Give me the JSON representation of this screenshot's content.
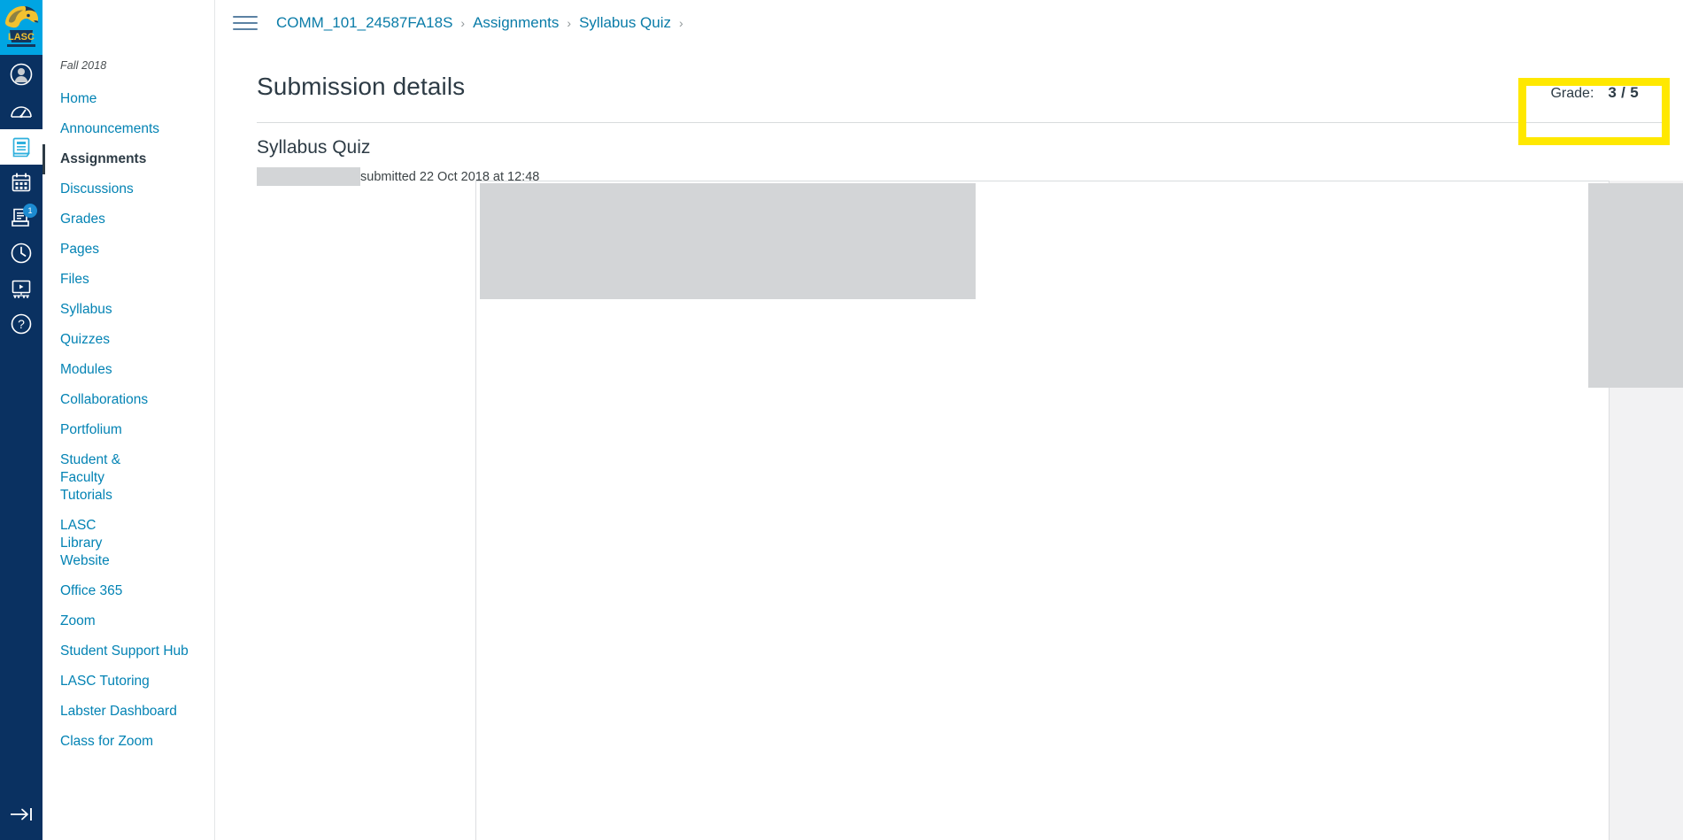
{
  "global_nav": {
    "logo": {
      "name": "lasc-cougar-logo",
      "alt": "LASC Cougar logo"
    },
    "items": [
      {
        "id": "account",
        "label": "Account",
        "icon": "account-avatar-icon",
        "active": false,
        "badge": null
      },
      {
        "id": "dashboard",
        "label": "Dashboard",
        "icon": "dashboard-gauge-icon",
        "active": false,
        "badge": null
      },
      {
        "id": "courses",
        "label": "Courses",
        "icon": "courses-book-icon",
        "active": true,
        "badge": null
      },
      {
        "id": "calendar",
        "label": "Calendar",
        "icon": "calendar-icon",
        "active": false,
        "badge": null
      },
      {
        "id": "inbox",
        "label": "Inbox",
        "icon": "inbox-icon",
        "active": false,
        "badge": "1"
      },
      {
        "id": "history",
        "label": "History",
        "icon": "clock-history-icon",
        "active": false,
        "badge": null
      },
      {
        "id": "studio",
        "label": "Studio",
        "icon": "studio-screen-icon",
        "active": false,
        "badge": null
      },
      {
        "id": "help",
        "label": "Help",
        "icon": "help-question-icon",
        "active": false,
        "badge": null
      }
    ],
    "collapse": {
      "label": "Expand global navigation",
      "icon": "arrow-right-bar-icon"
    }
  },
  "header": {
    "menu_button_label": "Menu",
    "menu_icon": "hamburger-icon",
    "breadcrumbs": [
      {
        "label": "COMM_101_24587FA18S"
      },
      {
        "label": "Assignments"
      },
      {
        "label": "Syllabus Quiz"
      }
    ],
    "breadcrumb_separator": "›"
  },
  "course_nav": {
    "term": "Fall 2018",
    "items": [
      {
        "label": "Home",
        "active": false
      },
      {
        "label": "Announcements",
        "active": false
      },
      {
        "label": "Assignments",
        "active": true
      },
      {
        "label": "Discussions",
        "active": false
      },
      {
        "label": "Grades",
        "active": false
      },
      {
        "label": "Pages",
        "active": false
      },
      {
        "label": "Files",
        "active": false
      },
      {
        "label": "Syllabus",
        "active": false
      },
      {
        "label": "Quizzes",
        "active": false
      },
      {
        "label": "Modules",
        "active": false
      },
      {
        "label": "Collaborations",
        "active": false
      },
      {
        "label": "Portfolium",
        "active": false
      },
      {
        "label": "Student & Faculty Tutorials",
        "active": false
      },
      {
        "label": "LASC Library Website",
        "active": false
      },
      {
        "label": "Office 365",
        "active": false
      },
      {
        "label": "Zoom",
        "active": false
      },
      {
        "label": "Student Support Hub",
        "active": false
      },
      {
        "label": "LASC Tutoring",
        "active": false
      },
      {
        "label": "Labster Dashboard",
        "active": false
      },
      {
        "label": "Class for Zoom",
        "active": false
      }
    ]
  },
  "main": {
    "page_title": "Submission details",
    "assignment_title": "Syllabus Quiz",
    "submitted_text": "submitted 22 Oct 2018 at 12:48",
    "student_name_redacted": "",
    "grade": {
      "label": "Grade:",
      "value": "3 / 5",
      "score": 3,
      "points_possible": 5
    }
  },
  "annotation": {
    "highlight_color": "#ffe800",
    "highlight_target": "grade-box"
  },
  "colors": {
    "rail_background": "#0a3161",
    "logo_background": "#00a5e3",
    "link": "#0383b4",
    "breadcrumb_link": "#0a7ca8",
    "text": "#2d3b45",
    "panel_background": "#f2f2f3",
    "redaction": "#d3d5d7",
    "border": "#dcdee0",
    "badge": "#1c8bd1"
  }
}
